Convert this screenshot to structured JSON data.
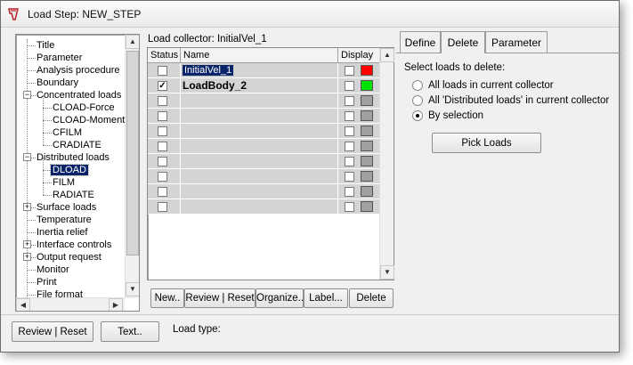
{
  "window": {
    "title": "Load Step: NEW_STEP"
  },
  "tree": {
    "items": [
      {
        "label": "Title",
        "level": 0,
        "expander": ""
      },
      {
        "label": "Parameter",
        "level": 0,
        "expander": ""
      },
      {
        "label": "Analysis procedure",
        "level": 0,
        "expander": ""
      },
      {
        "label": "Boundary",
        "level": 0,
        "expander": ""
      },
      {
        "label": "Concentrated loads",
        "level": 0,
        "expander": "−"
      },
      {
        "label": "CLOAD-Force",
        "level": 1,
        "expander": ""
      },
      {
        "label": "CLOAD-Moment",
        "level": 1,
        "expander": ""
      },
      {
        "label": "CFILM",
        "level": 1,
        "expander": ""
      },
      {
        "label": "CRADIATE",
        "level": 1,
        "expander": ""
      },
      {
        "label": "Distributed loads",
        "level": 0,
        "expander": "−"
      },
      {
        "label": "DLOAD",
        "level": 1,
        "expander": "",
        "selected": true
      },
      {
        "label": "FILM",
        "level": 1,
        "expander": ""
      },
      {
        "label": "RADIATE",
        "level": 1,
        "expander": ""
      },
      {
        "label": "Surface loads",
        "level": 0,
        "expander": "+"
      },
      {
        "label": "Temperature",
        "level": 0,
        "expander": ""
      },
      {
        "label": "Inertia relief",
        "level": 0,
        "expander": ""
      },
      {
        "label": "Interface controls",
        "level": 0,
        "expander": "+"
      },
      {
        "label": "Output request",
        "level": 0,
        "expander": "+"
      },
      {
        "label": "Monitor",
        "level": 0,
        "expander": ""
      },
      {
        "label": "Print",
        "level": 0,
        "expander": ""
      },
      {
        "label": "File format",
        "level": 0,
        "expander": ""
      }
    ]
  },
  "collector": {
    "label": "Load collector: InitialVel_1",
    "columns": [
      "Status",
      "Name",
      "Display"
    ],
    "rows": [
      {
        "status": false,
        "name": "InitialVel_1",
        "selected": true,
        "bold": false,
        "display": false,
        "color": "#ff0000"
      },
      {
        "status": true,
        "name": "LoadBody_2",
        "selected": false,
        "bold": true,
        "display": false,
        "color": "#00e000"
      },
      {
        "status": false,
        "name": "",
        "display": false,
        "color": "#a0a0a0"
      },
      {
        "status": false,
        "name": "",
        "display": false,
        "color": "#a0a0a0"
      },
      {
        "status": false,
        "name": "",
        "display": false,
        "color": "#a0a0a0"
      },
      {
        "status": false,
        "name": "",
        "display": false,
        "color": "#a0a0a0"
      },
      {
        "status": false,
        "name": "",
        "display": false,
        "color": "#a0a0a0"
      },
      {
        "status": false,
        "name": "",
        "display": false,
        "color": "#a0a0a0"
      },
      {
        "status": false,
        "name": "",
        "display": false,
        "color": "#a0a0a0"
      },
      {
        "status": false,
        "name": "",
        "display": false,
        "color": "#a0a0a0"
      }
    ],
    "buttons": {
      "new": "New..",
      "review": "Review | Reset",
      "organize": "Organize..",
      "label": "Label...",
      "delete": "Delete"
    }
  },
  "tabs": [
    {
      "label": "Define",
      "active": false
    },
    {
      "label": "Delete",
      "active": true
    },
    {
      "label": "Parameter",
      "active": false
    }
  ],
  "delete_panel": {
    "prompt": "Select loads to delete:",
    "options": [
      {
        "label": "All loads in current collector",
        "selected": false
      },
      {
        "label": "All 'Distributed loads' in current collector",
        "selected": false
      },
      {
        "label": "By selection",
        "selected": true
      }
    ],
    "pick_button": "Pick Loads"
  },
  "bottom": {
    "review_button": "Review | Reset",
    "text_button": "Text..",
    "load_type_label": "Load type:"
  },
  "colors": {
    "selection": "#0a246a",
    "grid_row": "#d4d4d4",
    "window_bg": "#f0f0f0"
  }
}
